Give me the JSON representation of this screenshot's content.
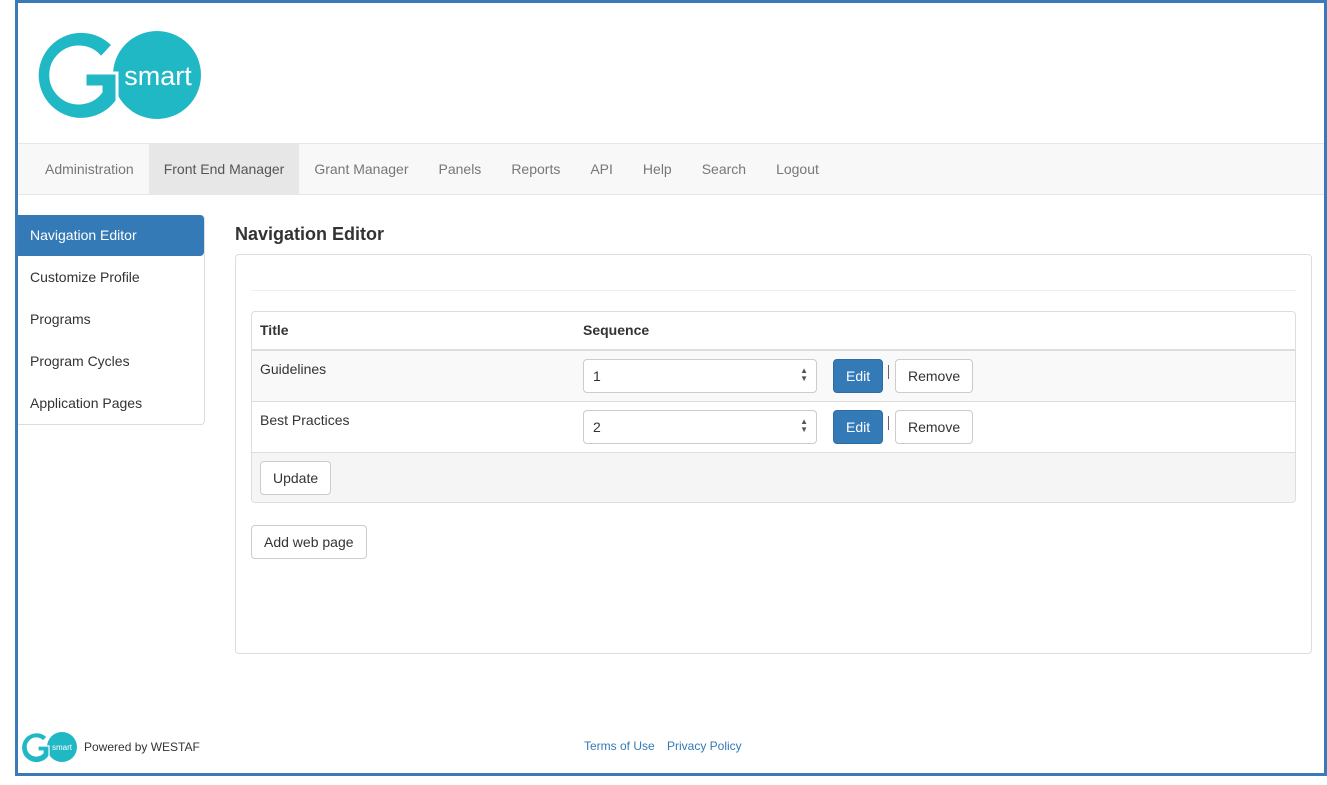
{
  "brand": {
    "logo_text": "smart",
    "color_teal": "#21b8c6"
  },
  "nav": {
    "items": [
      "Administration",
      "Front End Manager",
      "Grant Manager",
      "Panels",
      "Reports",
      "API",
      "Help",
      "Search",
      "Logout"
    ],
    "active": "Front End Manager"
  },
  "sidebar": {
    "items": [
      "Navigation Editor",
      "Customize Profile",
      "Programs",
      "Program Cycles",
      "Application Pages"
    ],
    "active": "Navigation Editor"
  },
  "main": {
    "heading": "Navigation Editor",
    "table": {
      "headers": {
        "title": "Title",
        "sequence": "Sequence"
      },
      "rows": [
        {
          "title": "Guidelines",
          "sequence": "1"
        },
        {
          "title": "Best Practices",
          "sequence": "2"
        }
      ],
      "edit_label": "Edit",
      "remove_label": "Remove",
      "separator": "|",
      "update_label": "Update"
    },
    "add_label": "Add web page"
  },
  "footer": {
    "logo_text": "smart",
    "powered": "Powered by WESTAF",
    "terms": "Terms of Use",
    "privacy": "Privacy Policy"
  },
  "colors": {
    "primary": "#337ab7",
    "frame": "#3a7ab8"
  }
}
